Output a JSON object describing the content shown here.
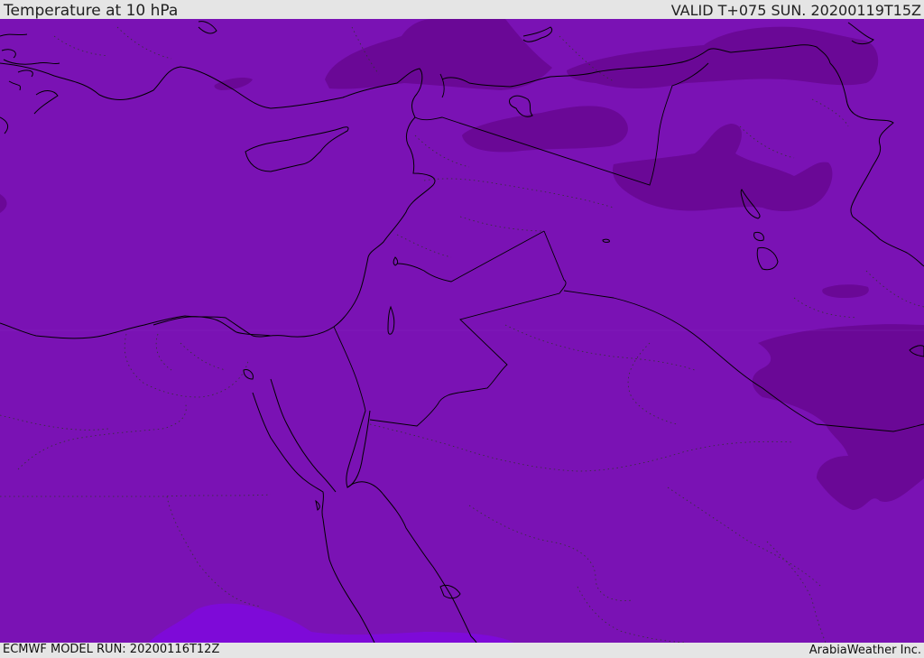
{
  "header": {
    "title": "Temperature at 10 hPa",
    "valid": "VALID T+075 SUN. 20200119T15Z"
  },
  "footer": {
    "model_run": "ECMWF MODEL RUN: 20200116T12Z",
    "credit": "ArabiaWeather Inc."
  },
  "map": {
    "colors": {
      "field_base": "#7a12b4",
      "field_cold": "#6a0896",
      "field_warm": "#7e0ad8",
      "coast": "#000000",
      "border_internal": "#333333"
    }
  }
}
